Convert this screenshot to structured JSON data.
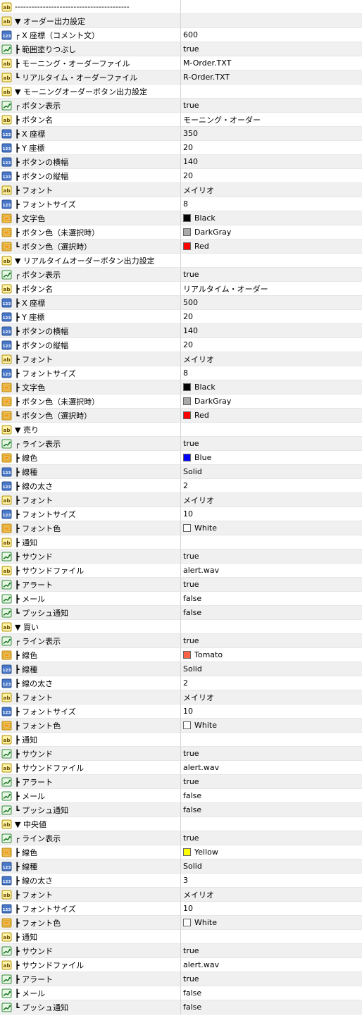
{
  "rows": [
    {
      "type": "ab",
      "name": "-----------------------------------------",
      "value": ""
    },
    {
      "type": "ab",
      "name": "▼ オーダー出力設定",
      "value": ""
    },
    {
      "type": "123",
      "name": "┌ X 座標（コメント文）",
      "value": "600"
    },
    {
      "type": "bool",
      "name": "┣ 範囲塗りつぶし",
      "value": "true"
    },
    {
      "type": "ab",
      "name": "┣ モーニング・オーダーファイル",
      "value": "M-Order.TXT"
    },
    {
      "type": "ab",
      "name": "┗ リアルタイム・オーダーファイル",
      "value": "R-Order.TXT"
    },
    {
      "type": "ab",
      "name": "▼ モーニングオーダーボタン出力設定",
      "value": ""
    },
    {
      "type": "bool",
      "name": "┌ ボタン表示",
      "value": "true"
    },
    {
      "type": "ab",
      "name": "┣ ボタン名",
      "value": "モーニング・オーダー"
    },
    {
      "type": "123",
      "name": "┣ X 座標",
      "value": "350"
    },
    {
      "type": "123",
      "name": "┣ Y 座標",
      "value": "20"
    },
    {
      "type": "123",
      "name": "┣ ボタンの横幅",
      "value": "140"
    },
    {
      "type": "123",
      "name": "┣ ボタンの縦幅",
      "value": "20"
    },
    {
      "type": "ab",
      "name": "┣ フォント",
      "value": "メイリオ"
    },
    {
      "type": "123",
      "name": "┣ フォントサイズ",
      "value": "8"
    },
    {
      "type": "color",
      "name": "┣ 文字色",
      "value": "Black",
      "color": "#000000"
    },
    {
      "type": "color",
      "name": "┣ ボタン色（未選択時）",
      "value": "DarkGray",
      "color": "#a9a9a9"
    },
    {
      "type": "color",
      "name": "┗ ボタン色（選択時）",
      "value": "Red",
      "color": "#ff0000"
    },
    {
      "type": "ab",
      "name": "▼ リアルタイムオーダーボタン出力設定",
      "value": ""
    },
    {
      "type": "bool",
      "name": "┌ ボタン表示",
      "value": "true"
    },
    {
      "type": "ab",
      "name": "┣ ボタン名",
      "value": "リアルタイム・オーダー"
    },
    {
      "type": "123",
      "name": "┣ X 座標",
      "value": "500"
    },
    {
      "type": "123",
      "name": "┣ Y 座標",
      "value": "20"
    },
    {
      "type": "123",
      "name": "┣ ボタンの横幅",
      "value": "140"
    },
    {
      "type": "123",
      "name": "┣ ボタンの縦幅",
      "value": "20"
    },
    {
      "type": "ab",
      "name": "┣ フォント",
      "value": "メイリオ"
    },
    {
      "type": "123",
      "name": "┣ フォントサイズ",
      "value": "8"
    },
    {
      "type": "color",
      "name": "┣ 文字色",
      "value": "Black",
      "color": "#000000"
    },
    {
      "type": "color",
      "name": "┣ ボタン色（未選択時）",
      "value": "DarkGray",
      "color": "#a9a9a9"
    },
    {
      "type": "color",
      "name": "┗ ボタン色（選択時）",
      "value": "Red",
      "color": "#ff0000"
    },
    {
      "type": "ab",
      "name": "▼ 売り",
      "value": ""
    },
    {
      "type": "bool",
      "name": "┌ ライン表示",
      "value": "true"
    },
    {
      "type": "color",
      "name": "┣ 線色",
      "value": "Blue",
      "color": "#0000ff"
    },
    {
      "type": "123",
      "name": "┣ 線種",
      "value": "Solid"
    },
    {
      "type": "123",
      "name": "┣ 線の太さ",
      "value": "2"
    },
    {
      "type": "ab",
      "name": "┣ フォント",
      "value": "メイリオ"
    },
    {
      "type": "123",
      "name": "┣ フォントサイズ",
      "value": "10"
    },
    {
      "type": "color",
      "name": "┣ フォント色",
      "value": "White",
      "color": "#ffffff"
    },
    {
      "type": "ab",
      "name": "┣ 通知",
      "value": ""
    },
    {
      "type": "bool",
      "name": "┣ サウンド",
      "value": "true"
    },
    {
      "type": "ab",
      "name": "┣ サウンドファイル",
      "value": "alert.wav"
    },
    {
      "type": "bool",
      "name": "┣ アラート",
      "value": "true"
    },
    {
      "type": "bool",
      "name": "┣ メール",
      "value": "false"
    },
    {
      "type": "bool",
      "name": "┗ プッシュ通知",
      "value": "false"
    },
    {
      "type": "ab",
      "name": "▼ 買い",
      "value": ""
    },
    {
      "type": "bool",
      "name": "┌ ライン表示",
      "value": "true"
    },
    {
      "type": "color",
      "name": "┣ 線色",
      "value": "Tomato",
      "color": "#ff6347"
    },
    {
      "type": "123",
      "name": "┣ 線種",
      "value": "Solid"
    },
    {
      "type": "123",
      "name": "┣ 線の太さ",
      "value": "2"
    },
    {
      "type": "ab",
      "name": "┣ フォント",
      "value": "メイリオ"
    },
    {
      "type": "123",
      "name": "┣ フォントサイズ",
      "value": "10"
    },
    {
      "type": "color",
      "name": "┣ フォント色",
      "value": "White",
      "color": "#ffffff"
    },
    {
      "type": "ab",
      "name": "┣ 通知",
      "value": ""
    },
    {
      "type": "bool",
      "name": "┣ サウンド",
      "value": "true"
    },
    {
      "type": "ab",
      "name": "┣ サウンドファイル",
      "value": "alert.wav"
    },
    {
      "type": "bool",
      "name": "┣ アラート",
      "value": "true"
    },
    {
      "type": "bool",
      "name": "┣ メール",
      "value": "false"
    },
    {
      "type": "bool",
      "name": "┗ プッシュ通知",
      "value": "false"
    },
    {
      "type": "ab",
      "name": "▼ 中央値",
      "value": ""
    },
    {
      "type": "bool",
      "name": "┌ ライン表示",
      "value": "true"
    },
    {
      "type": "color",
      "name": "┣ 線色",
      "value": "Yellow",
      "color": "#ffff00"
    },
    {
      "type": "123",
      "name": "┣ 線種",
      "value": "Solid"
    },
    {
      "type": "123",
      "name": "┣ 線の太さ",
      "value": "3"
    },
    {
      "type": "ab",
      "name": "┣ フォント",
      "value": "メイリオ"
    },
    {
      "type": "123",
      "name": "┣ フォントサイズ",
      "value": "10"
    },
    {
      "type": "color",
      "name": "┣ フォント色",
      "value": "White",
      "color": "#ffffff"
    },
    {
      "type": "ab",
      "name": "┣ 通知",
      "value": ""
    },
    {
      "type": "bool",
      "name": "┣ サウンド",
      "value": "true"
    },
    {
      "type": "ab",
      "name": "┣ サウンドファイル",
      "value": "alert.wav"
    },
    {
      "type": "bool",
      "name": "┣ アラート",
      "value": "true"
    },
    {
      "type": "bool",
      "name": "┣ メール",
      "value": "false"
    },
    {
      "type": "bool",
      "name": "┗ プッシュ通知",
      "value": "false"
    }
  ]
}
